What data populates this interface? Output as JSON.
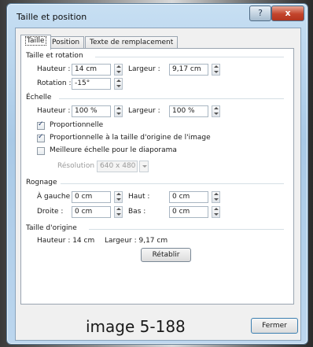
{
  "window": {
    "title": "Taille et position",
    "help_label": "?",
    "close_label": "x"
  },
  "tabs": [
    "Taille",
    "Position",
    "Texte de remplacement"
  ],
  "size_rotation": {
    "title": "Taille et rotation",
    "height_label": "Hauteur :",
    "height_value": "14 cm",
    "width_label": "Largeur :",
    "width_value": "9,17 cm",
    "rotation_label": "Rotation :",
    "rotation_value": "-15°"
  },
  "scale": {
    "title": "Échelle",
    "height_label": "Hauteur :",
    "height_value": "100 %",
    "width_label": "Largeur :",
    "width_value": "100 %",
    "proportional_label": "Proportionnelle",
    "relative_label": "Proportionnelle à la taille d'origine de l'image",
    "best_scale_label": "Meilleure échelle pour le diaporama",
    "resolution_label": "Résolution",
    "resolution_value": "640 x 480",
    "checks": {
      "proportional": true,
      "relative": true,
      "best_scale": false
    }
  },
  "crop": {
    "title": "Rognage",
    "left_label": "À gauche :",
    "left_value": "0 cm",
    "top_label": "Haut :",
    "top_value": "0 cm",
    "right_label": "Droite :",
    "right_value": "0 cm",
    "bottom_label": "Bas :",
    "bottom_value": "0 cm"
  },
  "original_size": {
    "title": "Taille d'origine",
    "height_text": "Hauteur : 14 cm",
    "width_text": "Largeur : 9,17 cm",
    "reset_label": "Rétablir"
  },
  "footer": {
    "caption": "image 5-188",
    "close_label": "Fermer"
  }
}
